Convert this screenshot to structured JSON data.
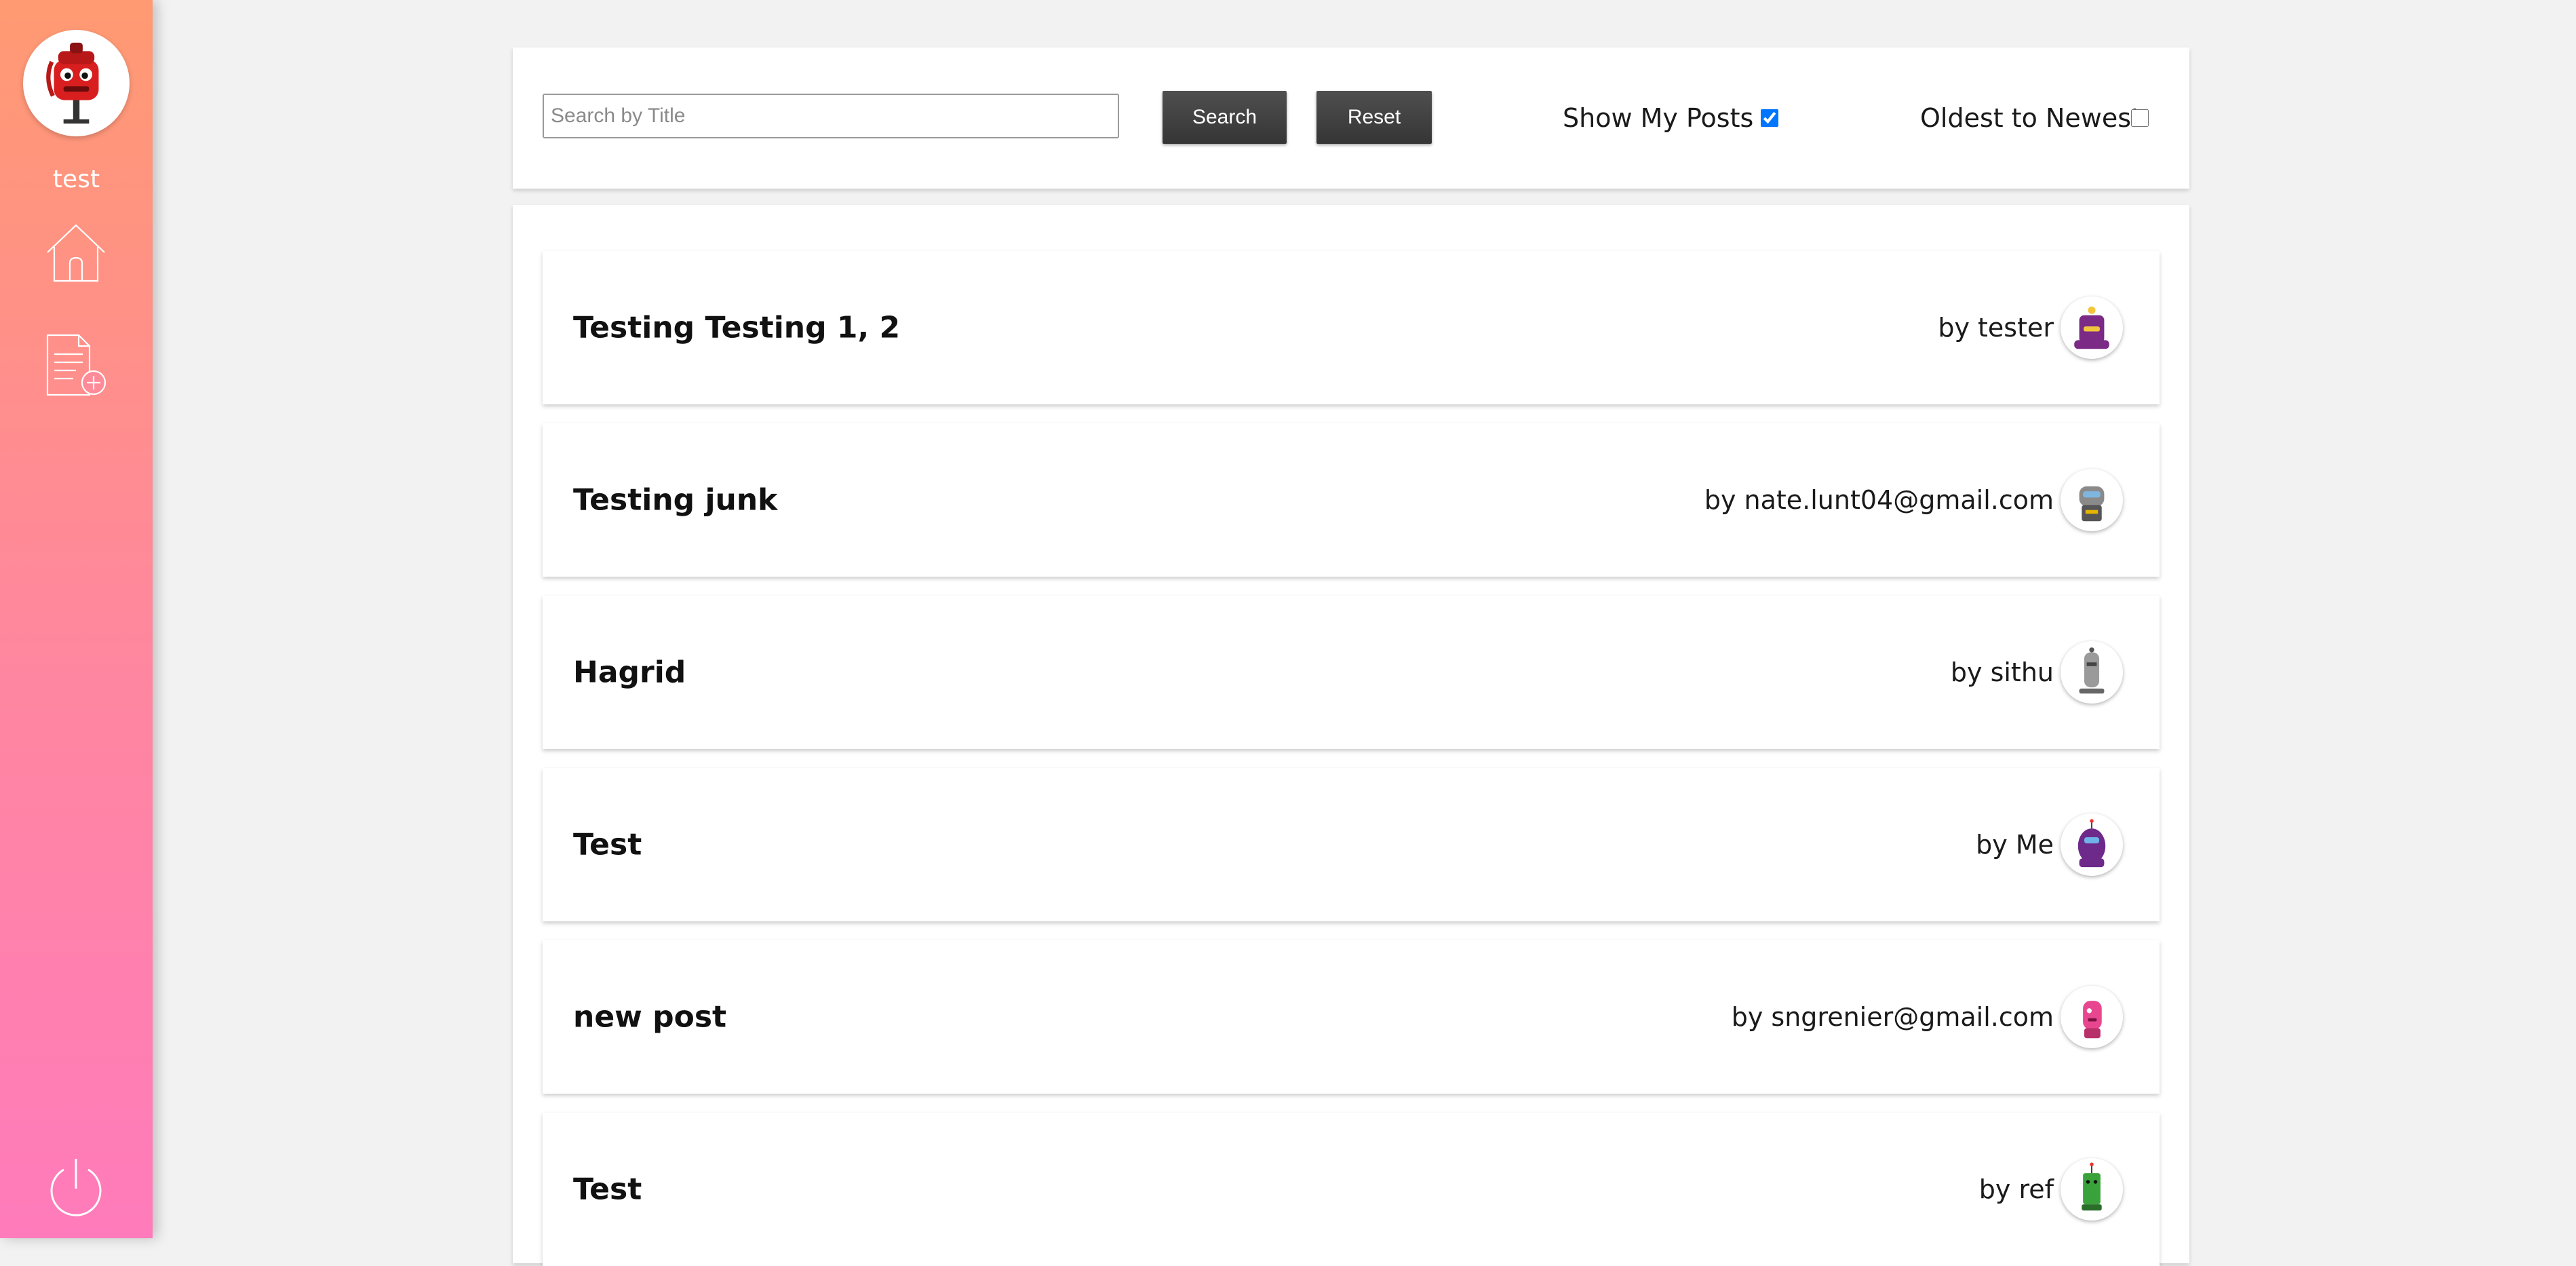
{
  "sidebar": {
    "username": "test",
    "avatar_icon": "red-robot-avatar",
    "nav": [
      {
        "name": "home-icon"
      },
      {
        "name": "new-post-icon"
      },
      {
        "name": "power-icon"
      }
    ]
  },
  "toolbar": {
    "search_placeholder": "Search by Title",
    "search_value": "",
    "search_label": "Search",
    "reset_label": "Reset",
    "show_my_posts_label": "Show My Posts",
    "show_my_posts_checked": true,
    "oldest_to_newest_label": "Oldest to Newest",
    "oldest_to_newest_checked": false
  },
  "posts": [
    {
      "title": "Testing Testing 1, 2",
      "author": "by tester",
      "avatar_color": "#7b2a86"
    },
    {
      "title": "Testing junk",
      "author": "by nate.lunt04@gmail.com",
      "avatar_color": "#8a8a8a"
    },
    {
      "title": "Hagrid",
      "author": "by sithu",
      "avatar_color": "#9a9a9a"
    },
    {
      "title": "Test",
      "author": "by Me",
      "avatar_color": "#6e2a8a"
    },
    {
      "title": "new post",
      "author": "by sngrenier@gmail.com",
      "avatar_color": "#e8478f"
    },
    {
      "title": "Test",
      "author": "by ref",
      "avatar_color": "#3aa23a"
    }
  ],
  "colors": {
    "sidebar_top": "#ff9a72",
    "sidebar_bottom": "#ff7bbb",
    "button_bg": "#404040",
    "background": "#f2f2f2"
  }
}
